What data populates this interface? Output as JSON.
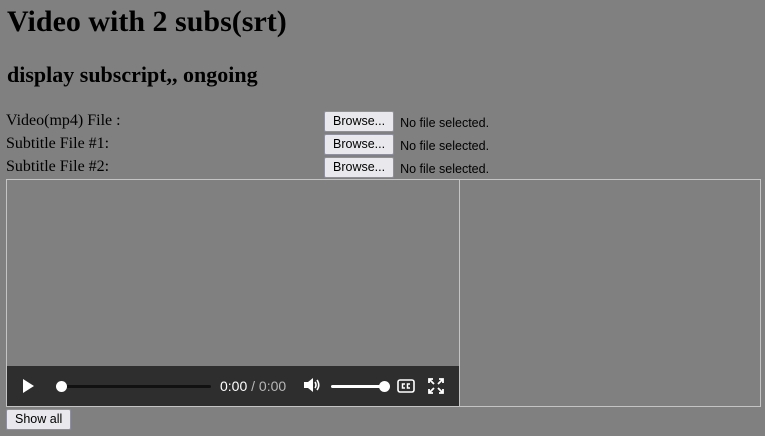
{
  "page": {
    "title": "Video with 2 subs(srt)",
    "subtitle": "display subscript,, ongoing"
  },
  "inputs": [
    {
      "label": "Video(mp4) File :",
      "button": "Browse...",
      "status": "No file selected."
    },
    {
      "label": "Subtitle File #1:",
      "button": "Browse...",
      "status": "No file selected."
    },
    {
      "label": "Subtitle File #2:",
      "button": "Browse...",
      "status": "No file selected."
    }
  ],
  "player": {
    "current_time": "0:00",
    "separator": " / ",
    "duration": "0:00",
    "progress": 0,
    "volume": 1.0,
    "icons": [
      "play-icon",
      "volume-icon",
      "closed-captions-icon",
      "fullscreen-icon"
    ]
  },
  "actions": {
    "show_all": "Show all"
  }
}
